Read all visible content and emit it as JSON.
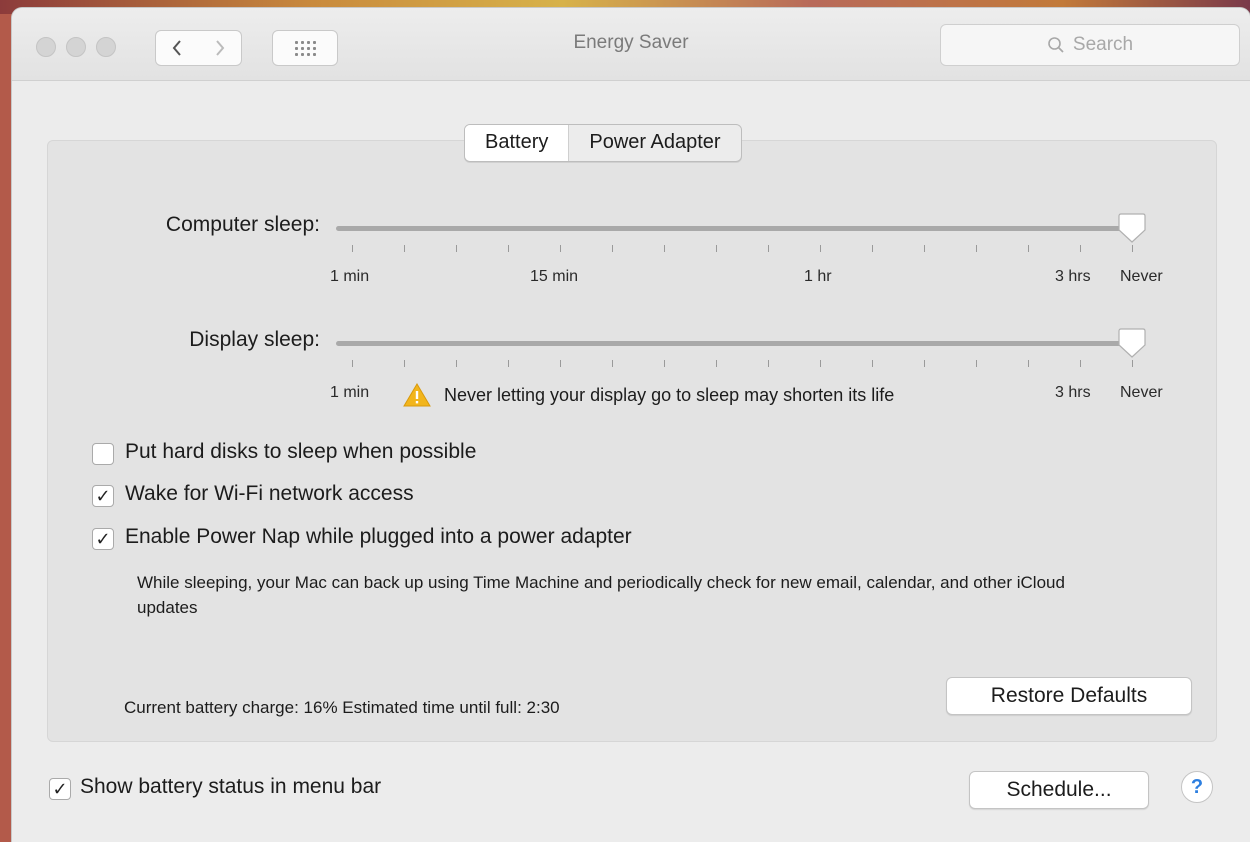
{
  "window": {
    "title": "Energy Saver",
    "search_placeholder": "Search"
  },
  "tabs": [
    {
      "label": "Battery",
      "selected": true
    },
    {
      "label": "Power Adapter",
      "selected": false
    }
  ],
  "sliders": {
    "computer_sleep": {
      "label": "Computer sleep:",
      "value": "Never",
      "tick_labels": [
        "1 min",
        "15 min",
        "1 hr",
        "3 hrs",
        "Never"
      ]
    },
    "display_sleep": {
      "label": "Display sleep:",
      "value": "Never",
      "tick_labels": [
        "1 min",
        "3 hrs",
        "Never"
      ],
      "warning": "Never letting your display go to sleep may shorten its life"
    }
  },
  "options": [
    {
      "label": "Put hard disks to sleep when possible",
      "checked": false
    },
    {
      "label": "Wake for Wi-Fi network access",
      "checked": true
    },
    {
      "label": "Enable Power Nap while plugged into a power adapter",
      "checked": true
    }
  ],
  "power_nap_description": "While sleeping, your Mac can back up using Time Machine and periodically check for new email, calendar, and other iCloud updates",
  "battery_status": "Current battery charge: 16%  Estimated time until full: 2:30",
  "restore_defaults_label": "Restore Defaults",
  "show_battery_status": {
    "label": "Show battery status in menu bar",
    "checked": true
  },
  "schedule_label": "Schedule...",
  "help_label": "?",
  "check_glyph": "✓",
  "icons": {
    "back": "chevron-left-icon",
    "forward": "chevron-right-icon",
    "grid": "grid-icon",
    "search": "search-icon",
    "warning": "warning-icon"
  },
  "colors": {
    "accent": "#2d7fe0",
    "warning": "#f2b51c"
  }
}
